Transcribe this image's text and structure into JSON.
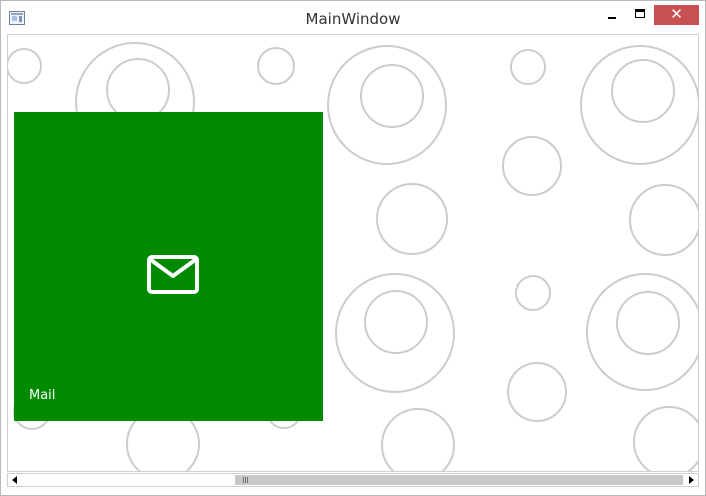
{
  "window": {
    "title": "MainWindow",
    "close_label": "✕"
  },
  "tile": {
    "label": "Mail",
    "background_color": "#008a00"
  },
  "colors": {
    "accent": "#008a00",
    "close_button": "#c75050",
    "circle_stroke": "#cccccc"
  },
  "scrollbar": {
    "position": 0.32
  }
}
